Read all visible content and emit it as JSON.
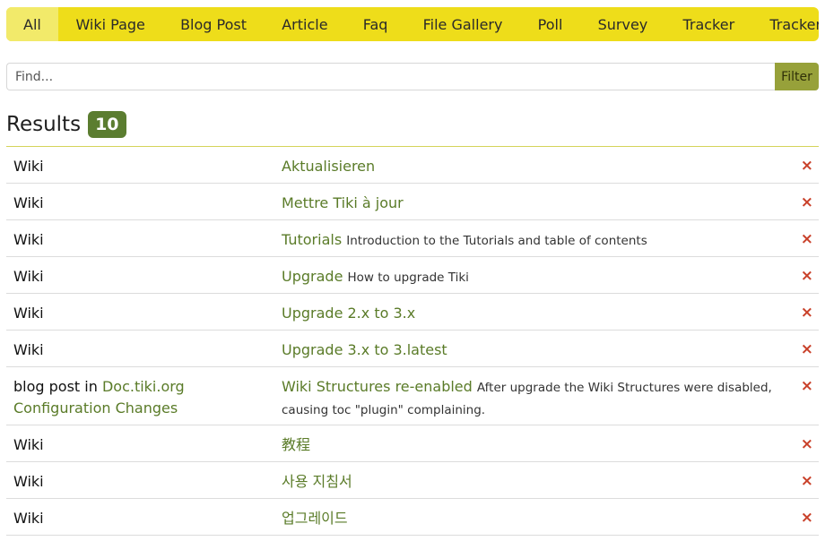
{
  "tabs": [
    {
      "label": "All"
    },
    {
      "label": "Wiki Page"
    },
    {
      "label": "Blog Post"
    },
    {
      "label": "Article"
    },
    {
      "label": "Faq"
    },
    {
      "label": "File Gallery"
    },
    {
      "label": "Poll"
    },
    {
      "label": "Survey"
    },
    {
      "label": "Tracker"
    },
    {
      "label": "Tracker Item"
    }
  ],
  "search": {
    "placeholder": "Find...",
    "button_label": "Filter"
  },
  "results": {
    "title": "Results",
    "count": "10"
  },
  "rows": [
    {
      "type": "Wiki",
      "title": "Aktualisieren",
      "desc": ""
    },
    {
      "type": "Wiki",
      "title": "Mettre Tiki à jour",
      "desc": ""
    },
    {
      "type": "Wiki",
      "title": "Tutorials",
      "desc": "Introduction to the Tutorials and table of contents"
    },
    {
      "type": "Wiki",
      "title": "Upgrade",
      "desc": "How to upgrade Tiki"
    },
    {
      "type": "Wiki",
      "title": "Upgrade 2.x to 3.x",
      "desc": ""
    },
    {
      "type": "Wiki",
      "title": "Upgrade 3.x to 3.latest",
      "desc": ""
    },
    {
      "type_prefix": "blog post in",
      "type_link": "Doc.tiki.org Configuration Changes",
      "title": "Wiki Structures re-enabled",
      "desc": "After upgrade the Wiki Structures were disabled, causing toc \"plugin\" complaining."
    },
    {
      "type": "Wiki",
      "title": "教程",
      "desc": ""
    },
    {
      "type": "Wiki",
      "title": "사용 지침서",
      "desc": ""
    },
    {
      "type": "Wiki",
      "title": "업그레이드",
      "desc": ""
    }
  ],
  "icons": {
    "delete": "×"
  },
  "colors": {
    "tab_bar": "#eedd1a",
    "active_tab": "#f2ea6a",
    "filter_button": "#97a13a",
    "badge": "#5b7d30",
    "link": "#5a7b28",
    "delete": "#c9412a"
  }
}
